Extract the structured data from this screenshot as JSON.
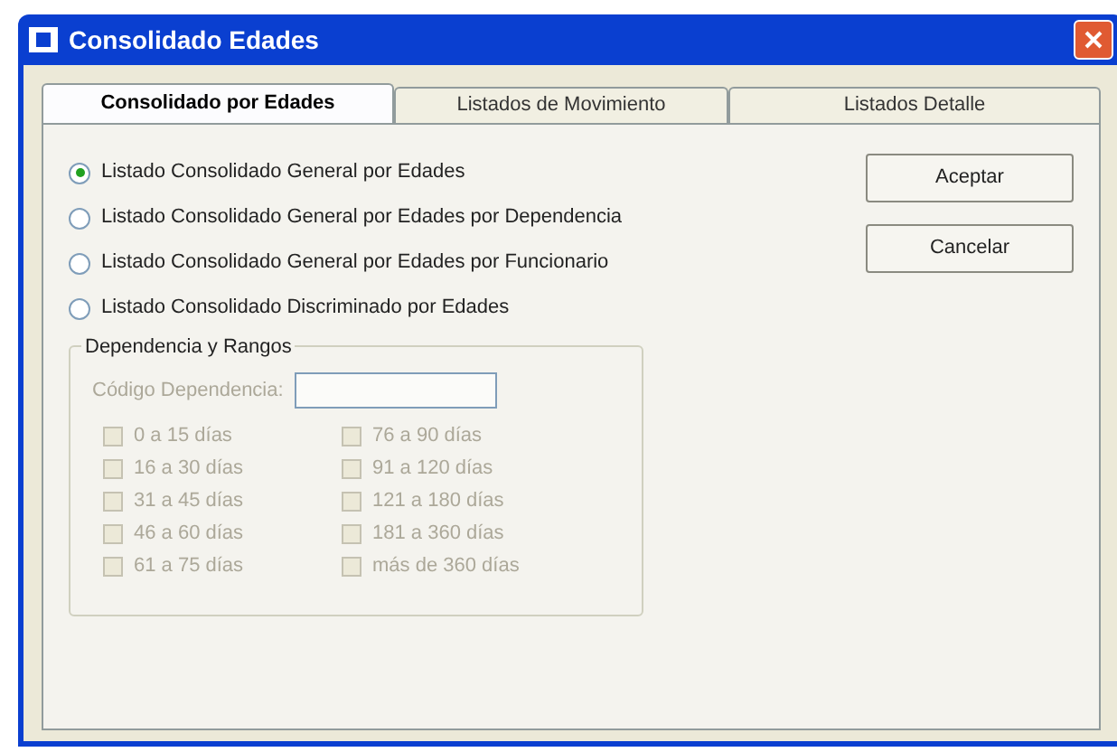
{
  "window": {
    "title": "Consolidado Edades"
  },
  "tabs": [
    {
      "label": "Consolidado por Edades",
      "selected": true
    },
    {
      "label": "Listados de Movimiento",
      "selected": false
    },
    {
      "label": "Listados Detalle",
      "selected": false
    }
  ],
  "options": [
    {
      "label": "Listado Consolidado General por Edades",
      "selected": true
    },
    {
      "label": "Listado Consolidado General por Edades por Dependencia",
      "selected": false
    },
    {
      "label": "Listado Consolidado General por Edades por Funcionario",
      "selected": false
    },
    {
      "label": "Listado Consolidado Discriminado por Edades",
      "selected": false
    }
  ],
  "group": {
    "title": "Dependencia y Rangos",
    "disabled": true,
    "field_label": "Código Dependencia:",
    "ranges": [
      {
        "label": "0 a 15 días",
        "checked": false
      },
      {
        "label": "16 a 30 días",
        "checked": false
      },
      {
        "label": "31 a 45 días",
        "checked": false
      },
      {
        "label": "46 a 60 días",
        "checked": false
      },
      {
        "label": "61 a 75 días",
        "checked": false
      },
      {
        "label": "76 a 90 días",
        "checked": false
      },
      {
        "label": "91 a 120 días",
        "checked": false
      },
      {
        "label": "121 a 180 días",
        "checked": false
      },
      {
        "label": "181 a 360 días",
        "checked": false
      },
      {
        "label": "más de 360 días",
        "checked": false
      }
    ]
  },
  "buttons": [
    "Aceptar",
    "Cancelar"
  ]
}
